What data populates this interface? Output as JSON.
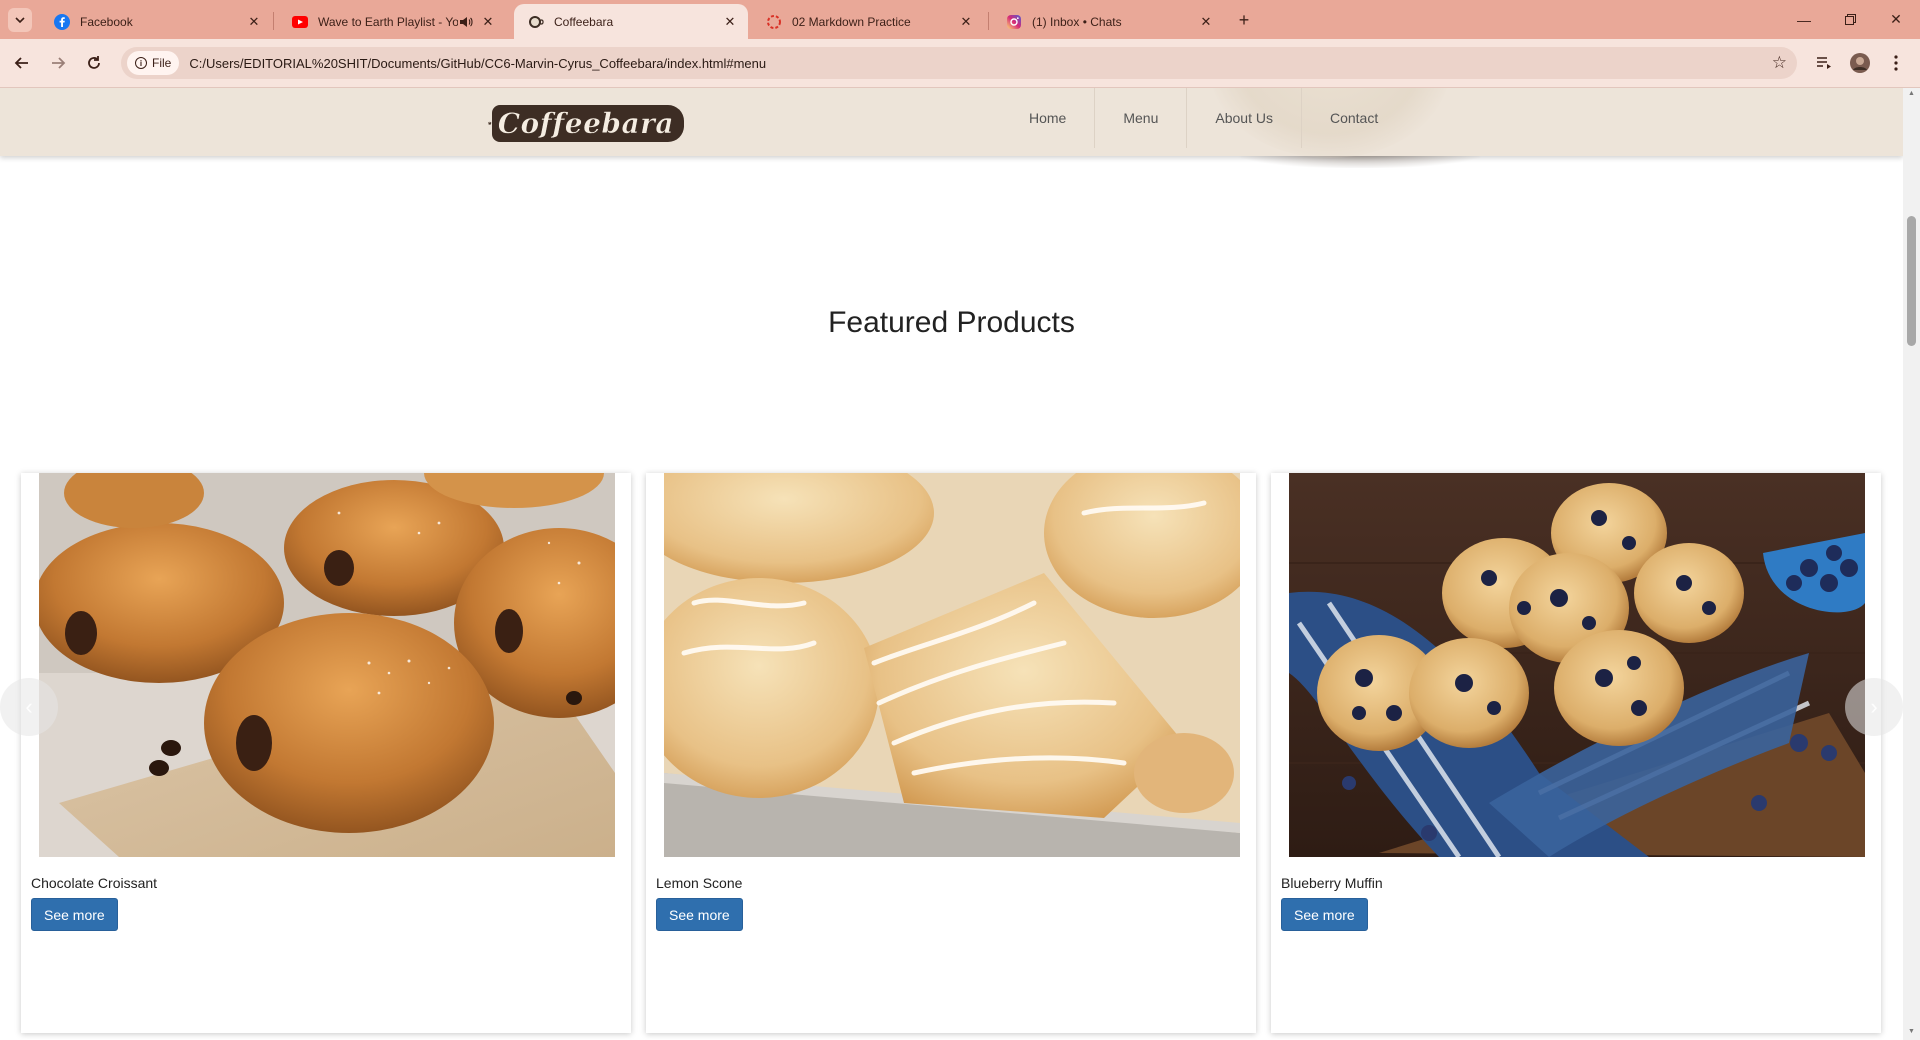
{
  "browser": {
    "tabs": [
      {
        "title": "Facebook",
        "icon": "facebook-icon"
      },
      {
        "title": "Wave to Earth Playlist - You",
        "icon": "youtube-icon",
        "audio": true
      },
      {
        "title": "Coffeebara",
        "icon": "coffee-icon",
        "active": true
      },
      {
        "title": "02 Markdown Practice",
        "icon": "loading-icon"
      },
      {
        "title": "(1) Inbox • Chats",
        "icon": "instagram-icon"
      }
    ],
    "address": {
      "chip_label": "File",
      "url": "C:/Users/EDITORIAL%20SHIT/Documents/GitHub/CC6-Marvin-Cyrus_Coffeebara/index.html#menu"
    },
    "colors": {
      "tabstrip": "#e9a898",
      "toolbar": "#f7e4dd"
    }
  },
  "site": {
    "brand": "Coffeebara",
    "nav": [
      "Home",
      "Menu",
      "About Us",
      "Contact"
    ],
    "section_title": "Featured Products",
    "products": [
      {
        "name": "Chocolate Croissant",
        "button": "See more",
        "image": "chocolate-croissant-photo"
      },
      {
        "name": "Lemon Scone",
        "button": "See more",
        "image": "lemon-scone-photo"
      },
      {
        "name": "Blueberry Muffin",
        "button": "See more",
        "image": "blueberry-muffin-photo"
      }
    ],
    "carousel": {
      "prev_icon": "chevron-left-icon",
      "next_icon": "chevron-right-icon"
    },
    "colors": {
      "nav_bg": "#ede4d9",
      "button": "#2f6fae"
    }
  }
}
